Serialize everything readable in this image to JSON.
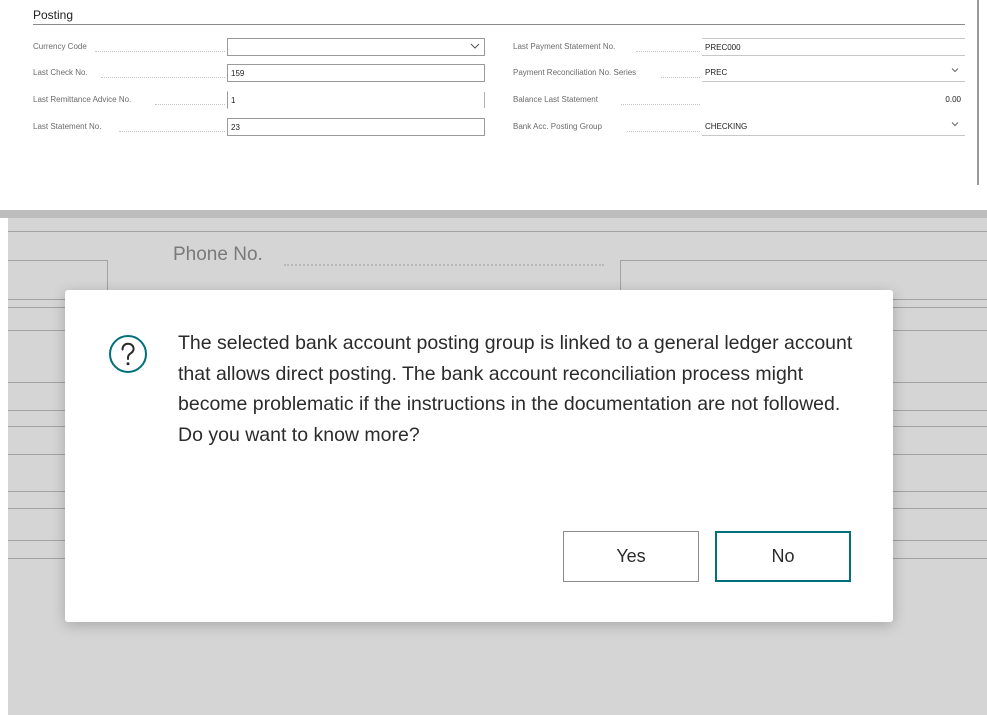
{
  "posting": {
    "title": "Posting",
    "left_fields": [
      {
        "label": "Currency Code",
        "value": ""
      },
      {
        "label": "Last Check No.",
        "value": "159"
      },
      {
        "label": "Last Remittance Advice No.",
        "value": "1"
      },
      {
        "label": "Last Statement No.",
        "value": "23"
      }
    ],
    "right_fields": [
      {
        "label": "Last Payment Statement No.",
        "value": "PREC000"
      },
      {
        "label": "Payment Reconciliation No. Series",
        "value": "PREC"
      },
      {
        "label": "Balance Last Statement",
        "value": "0.00"
      },
      {
        "label": "Bank Acc. Posting Group",
        "value": "CHECKING"
      }
    ]
  },
  "background": {
    "phone_label": "Phone No."
  },
  "dialog": {
    "icon": "question-circle-icon",
    "message": "The selected bank account posting group is linked to a general ledger account that allows direct posting. The bank account reconciliation process might become problematic if the instructions in the documentation are not followed. Do you want to know more?",
    "yes_label": "Yes",
    "no_label": "No"
  },
  "colors": {
    "accent": "#00707a",
    "overlay": "#d5d5d5"
  }
}
